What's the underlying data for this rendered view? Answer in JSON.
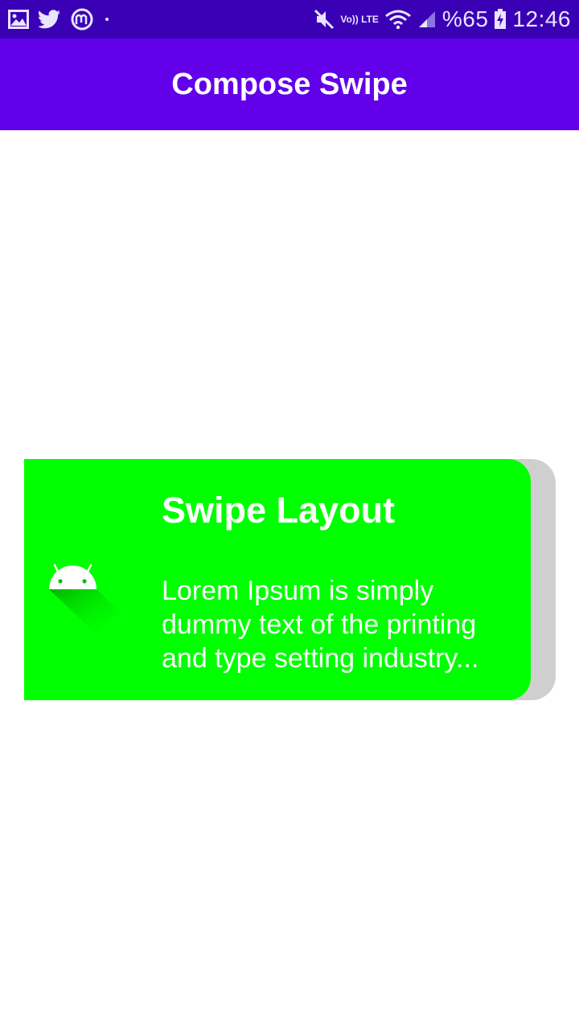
{
  "status_bar": {
    "left_icons": [
      "gallery-icon",
      "twitter-icon",
      "coin-app-icon",
      "notification-dot-icon"
    ],
    "lte_label": "Vo)) LTE",
    "battery_text": "%65",
    "time": "12:46"
  },
  "app_bar": {
    "title": "Compose Swipe"
  },
  "swipe_card": {
    "title": "Swipe Layout",
    "body": "Lorem Ipsum is simply dummy text of the printing and type setting industry...",
    "icon": "android-icon",
    "card_color": "#00ff00",
    "reveal_color": "#cfcfcf"
  },
  "colors": {
    "status_bar": "#3a00b5",
    "app_bar": "#6200ea",
    "text_on_color": "#ffffff"
  }
}
